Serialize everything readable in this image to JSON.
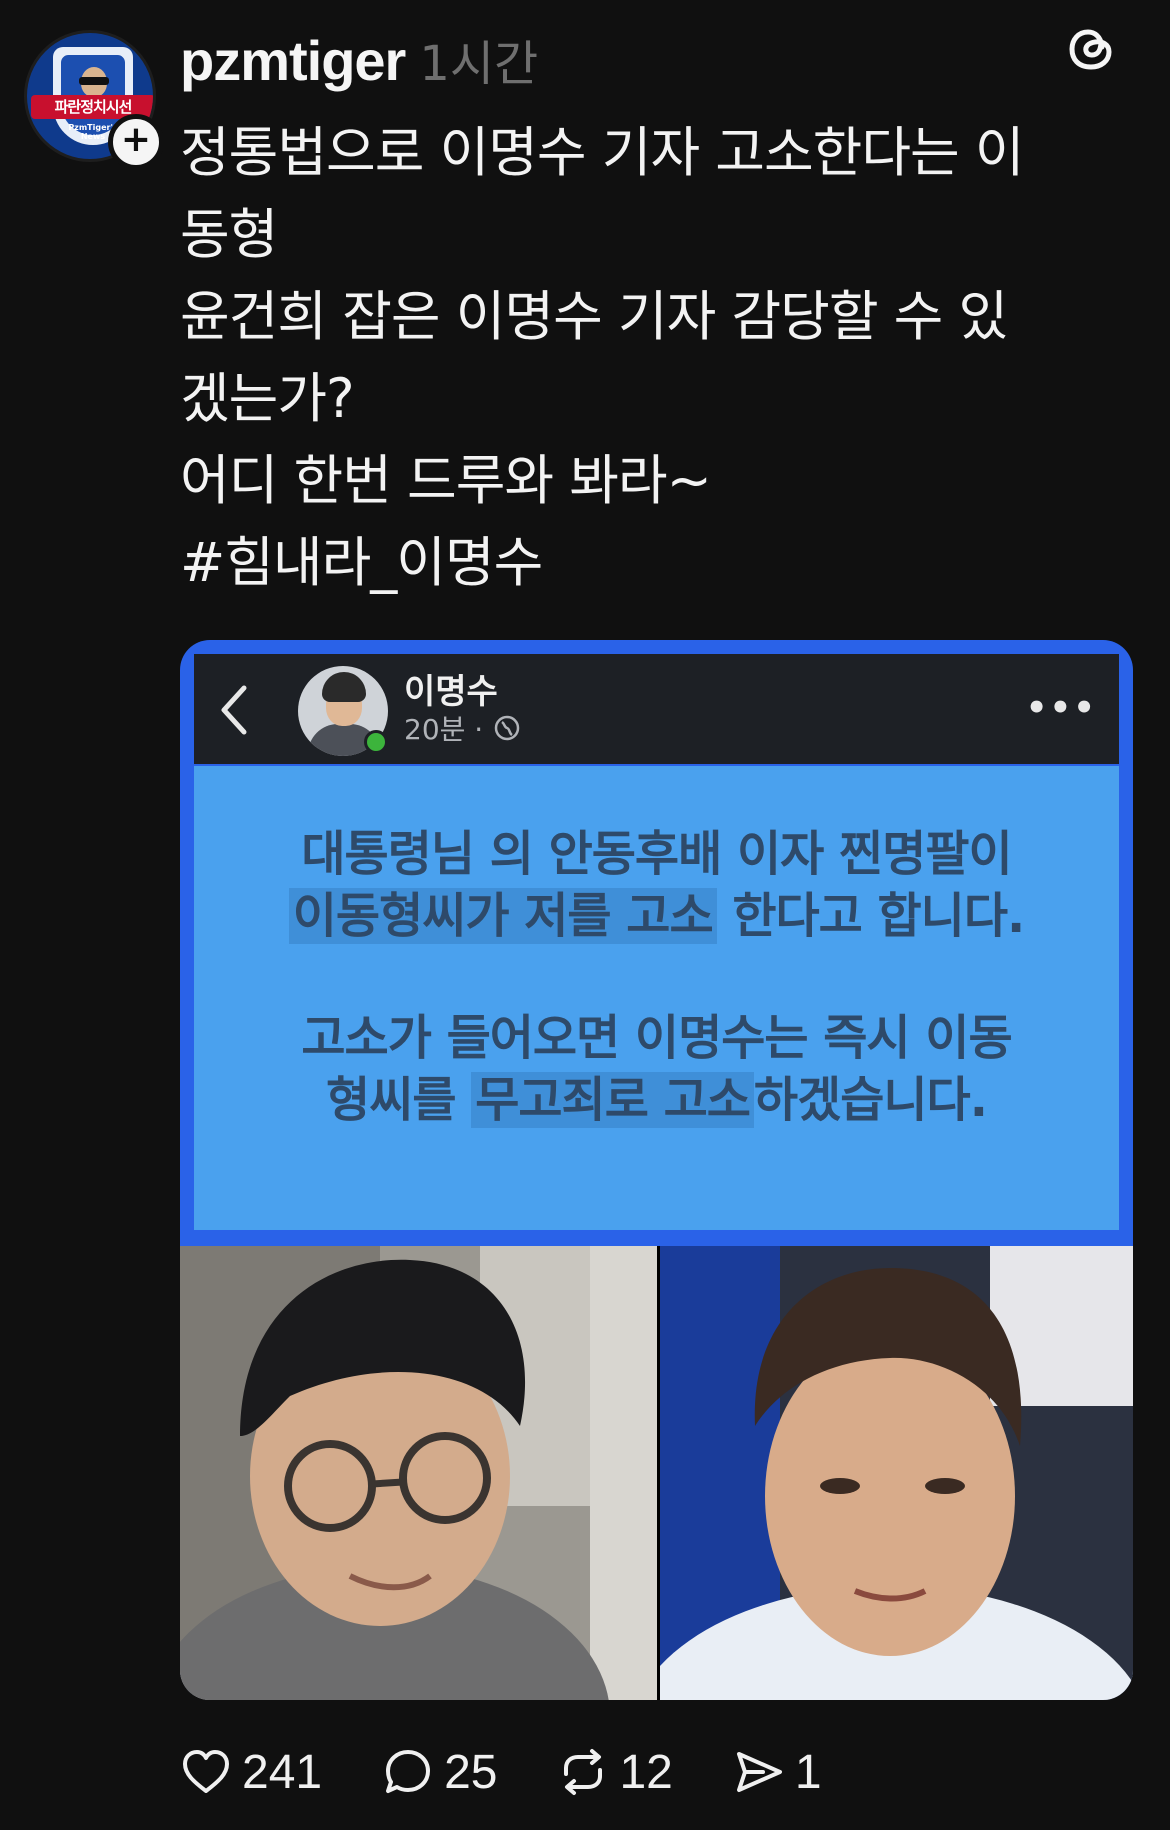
{
  "post": {
    "username": "pzmtiger",
    "time": "1시간",
    "avatar_banner": "파란정치시선",
    "avatar_sub": "PzmTiger's News",
    "text_lines": [
      "정통법으로 이명수 기자 고소한다는 이",
      "동형",
      "윤건희 잡은 이명수 기자 감당할 수 있",
      "겠는가?",
      "어디 한번 드루와 봐라~",
      "#힘내라_이명수"
    ]
  },
  "embedded": {
    "author": "이명수",
    "meta_time": "20분 ·",
    "more": "•••",
    "lines": {
      "l1": "대통령님 의 안동후배 이자 찐명팔이",
      "l2a": "이동형씨가 저를 고소",
      "l2b": " 한다고 합니다.",
      "l3": "고소가 들어오면 이명수는 즉시 이동",
      "l4a": "형씨를 ",
      "l4b": "무고죄로 고소",
      "l4c": "하겠습니다."
    }
  },
  "actions": {
    "likes": "241",
    "comments": "25",
    "reposts": "12",
    "shares": "1"
  },
  "colors": {
    "background": "#101010",
    "media_frame": "#2a62e8",
    "fb_body": "#4aa1ee",
    "muted": "#6f6f6f"
  }
}
